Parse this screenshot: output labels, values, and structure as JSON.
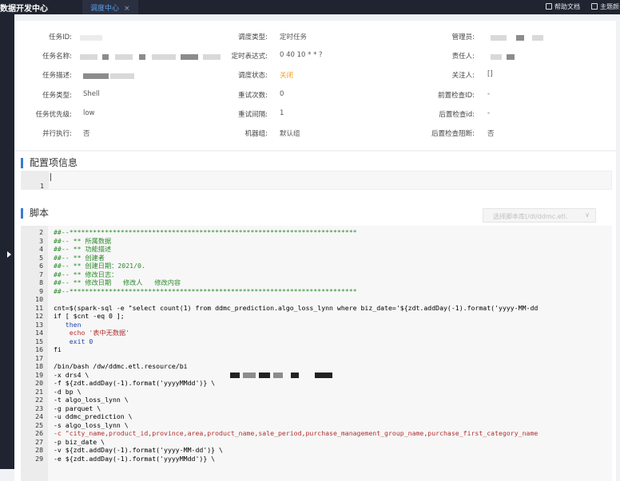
{
  "topbar": {
    "brand": "数据开发中心",
    "tab_label": "调度中心",
    "tab_close": "×",
    "help_label": "帮助文档",
    "theme_label": "主题颜"
  },
  "info": {
    "rows": [
      [
        {
          "label": "任务ID:",
          "value": ""
        },
        {
          "label": "调度类型:",
          "value": "定时任务"
        },
        {
          "label": "管理员:",
          "value": ""
        }
      ],
      [
        {
          "label": "任务名称:",
          "value": ""
        },
        {
          "label": "定时表达式:",
          "value": "0 40 10 * * ?"
        },
        {
          "label": "责任人:",
          "value": ""
        }
      ],
      [
        {
          "label": "任务描述:",
          "value": ""
        },
        {
          "label": "调度状态:",
          "value": "关闭"
        },
        {
          "label": "关注人:",
          "value": "[]"
        }
      ],
      [
        {
          "label": "任务类型:",
          "value": "Shell"
        },
        {
          "label": "重试次数:",
          "value": "0"
        },
        {
          "label": "前置检查ID:",
          "value": "-"
        }
      ],
      [
        {
          "label": "任务优先级:",
          "value": "low"
        },
        {
          "label": "重试间隔:",
          "value": "1"
        },
        {
          "label": "后置检查id:",
          "value": "-"
        }
      ],
      [
        {
          "label": "并行执行:",
          "value": "否"
        },
        {
          "label": "机器组:",
          "value": "默认组"
        },
        {
          "label": "后置检查阻断:",
          "value": "否"
        }
      ]
    ],
    "status_color": "#f0a020"
  },
  "config": {
    "title": "配置项信息",
    "line1": "1"
  },
  "script": {
    "title": "脚本",
    "repo_placeholder": "选择脚本库(/dl/ddmc.etl.",
    "repo_chevron": "∨",
    "lines": [
      {
        "n": "2",
        "t": "##--*************************************************************************"
      },
      {
        "n": "3",
        "t": "##-- ** 所属数据"
      },
      {
        "n": "4",
        "t": "##-- ** 功能描述"
      },
      {
        "n": "5",
        "t": "##-- ** 创建者"
      },
      {
        "n": "6",
        "t": "##-- ** 创建日期：2021/0."
      },
      {
        "n": "7",
        "t": "##-- ** 修改日志："
      },
      {
        "n": "8",
        "t": "##-- ** 修改日期   修改人   修改内容"
      },
      {
        "n": "9",
        "t": "##--*************************************************************************"
      },
      {
        "n": "10",
        "t": ""
      },
      {
        "n": "11",
        "t": "cnt=$(spark-sql -e \"select count(1) from ddmc_prediction.algo_loss_lynn where biz_date='${zdt.addDay(-1).format('yyyy-MM-dd"
      },
      {
        "n": "12",
        "t": "if [ $cnt -eq 0 ];"
      },
      {
        "n": "13",
        "t": "   then"
      },
      {
        "n": "14",
        "t": "    echo '表中无数据'"
      },
      {
        "n": "15",
        "t": "    exit 0"
      },
      {
        "n": "16",
        "t": "fi"
      },
      {
        "n": "17",
        "t": ""
      },
      {
        "n": "18",
        "t": "/bin/bash /dw/ddmc.etl.resource/bi"
      },
      {
        "n": "19",
        "t": "-x drs4 \\"
      },
      {
        "n": "20",
        "t": "-f ${zdt.addDay(-1).format('yyyyMMdd')} \\"
      },
      {
        "n": "21",
        "t": "-d bp \\"
      },
      {
        "n": "22",
        "t": "-t algo_loss_lynn \\"
      },
      {
        "n": "23",
        "t": "-g parquet \\"
      },
      {
        "n": "24",
        "t": "-u ddmc_prediction \\"
      },
      {
        "n": "25",
        "t": "-s algo_loss_lynn \\"
      },
      {
        "n": "26",
        "t": "-c \"city_name,product_id,province,area,product_name,sale_period,purchase_management_group_name,purchase_first_category_name"
      },
      {
        "n": "27",
        "t": "-p biz_date \\"
      },
      {
        "n": "28",
        "t": "-v ${zdt.addDay(-1).format('yyyy-MM-dd')} \\"
      },
      {
        "n": "29",
        "t": "-e ${zdt.addDay(-1).format('yyyyMMdd')} \\"
      }
    ]
  }
}
